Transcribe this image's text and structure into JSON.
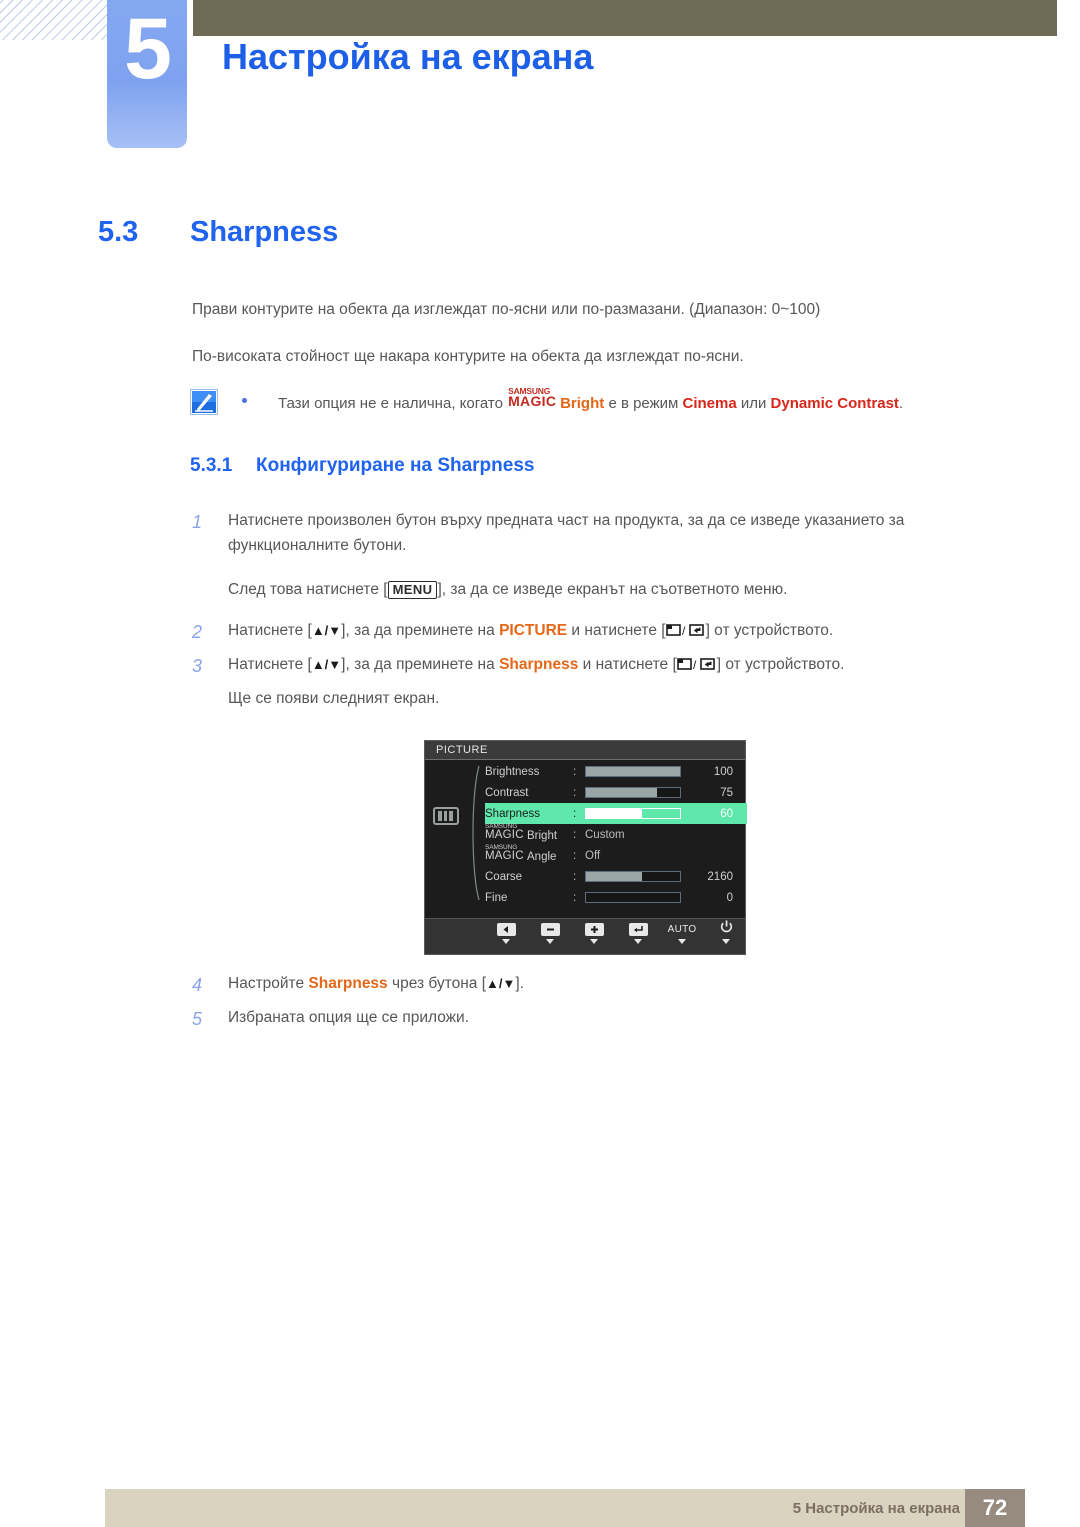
{
  "header": {
    "chapter_number": "5",
    "chapter_title": "Настройка на екрана"
  },
  "section": {
    "number": "5.3",
    "title": "Sharpness",
    "paragraph_1": "Прави контурите на обекта да изглеждат по-ясни или по-размазани. (Диапазон: 0~100)",
    "paragraph_2": "По-високата стойност ще накара контурите на обекта да изглеждат по-ясни."
  },
  "note": {
    "icon": "note-pencil-icon",
    "text_before": "Тази опция не е налична, когато",
    "magic_top": "SAMSUNG",
    "magic_bottom": "MAGIC",
    "bright_word": "Bright",
    "text_middle": "е в режим",
    "mode_1": "Cinema",
    "conjunction": "или",
    "mode_2": "Dynamic Contrast",
    "period": "."
  },
  "subsection": {
    "number": "5.3.1",
    "title": "Конфигуриране на Sharpness"
  },
  "steps": [
    {
      "num": "1",
      "text": "Натиснете произволен бутон върху предната част на продукта, за да се изведе указанието за функционалните бутони."
    },
    {
      "num": "",
      "text_before": "След това натиснете [",
      "key": "MENU",
      "text_after": "], за да се изведе екранът на съответното меню."
    },
    {
      "num": "2",
      "text_before": "Натиснете [",
      "arrows": "▲/▼",
      "text_mid": "], за да преминете на",
      "highlight": "PICTURE",
      "text_mid2": "и натиснете [",
      "glyph": "source-enter-icons",
      "text_after": "] от устройството."
    },
    {
      "num": "3",
      "text_before": "Натиснете [",
      "arrows": "▲/▼",
      "text_mid": "], за да преминете на",
      "highlight": "Sharpness",
      "text_mid2": "и натиснете [",
      "glyph": "source-enter-icons",
      "text_after": "] от устройството."
    },
    {
      "num": "",
      "text": "Ще се появи следният екран."
    },
    {
      "num": "4",
      "text_before": "Настройте",
      "highlight": "Sharpness",
      "text_mid": "чрез бутона [",
      "arrows": "▲/▼",
      "text_after": "]."
    },
    {
      "num": "5",
      "text": "Избраната опция ще се приложи."
    }
  ],
  "osd": {
    "title": "PICTURE",
    "side_icon": "picture-bars-icon",
    "rows": [
      {
        "label": "Brightness",
        "type": "slider",
        "value": "100",
        "percent": 100,
        "selected": false
      },
      {
        "label": "Contrast",
        "type": "slider",
        "value": "75",
        "percent": 75,
        "selected": false
      },
      {
        "label": "Sharpness",
        "type": "slider",
        "value": "60",
        "percent": 60,
        "selected": true
      },
      {
        "label_top": "SAMSUNG",
        "label_main": "MAGIC",
        "label_suffix": "Bright",
        "type": "text",
        "value": "Custom",
        "selected": false
      },
      {
        "label_top": "SAMSUNG",
        "label_main": "MAGIC",
        "label_suffix": "Angle",
        "type": "text",
        "value": "Off",
        "selected": false
      },
      {
        "label": "Coarse",
        "type": "slider",
        "value": "2160",
        "percent": 60,
        "selected": false
      },
      {
        "label": "Fine",
        "type": "slider",
        "value": "0",
        "percent": 0,
        "selected": false
      }
    ],
    "footer_buttons": [
      {
        "name": "back-icon",
        "glyph": "◀",
        "caret": true
      },
      {
        "name": "minus-icon",
        "glyph": "−",
        "caret": true
      },
      {
        "name": "plus-icon",
        "glyph": "+",
        "caret": true
      },
      {
        "name": "enter-icon",
        "glyph": "↵",
        "caret": true
      },
      {
        "name": "auto-label",
        "glyph": "AUTO",
        "caret": true
      },
      {
        "name": "power-icon",
        "glyph": "⏻",
        "caret": true
      }
    ]
  },
  "footer": {
    "text": "5 Настройка на екрана",
    "page": "72"
  },
  "colors": {
    "accent_blue": "#1f63ef",
    "orange": "#e56717",
    "red": "#c42b20",
    "olive": "#6e6b55",
    "tab_blue": "#7fa2f0",
    "footer_beige": "#d9d3c0",
    "page_box": "#978b80",
    "osd_highlight": "#5ee8ab"
  }
}
